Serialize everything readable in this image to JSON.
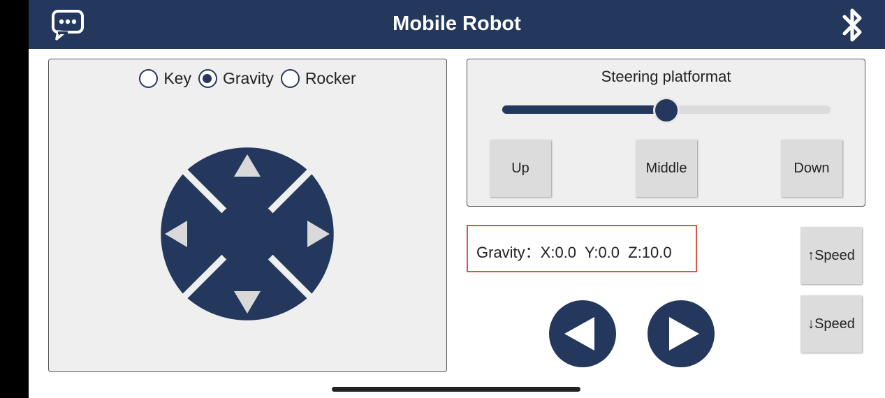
{
  "header": {
    "title": "Mobile Robot",
    "chat_icon": "chat-bubble-icon",
    "bluetooth_icon": "bluetooth-icon",
    "bg_color": "#23385c"
  },
  "control_panel": {
    "modes": [
      {
        "label": "Key",
        "checked": false
      },
      {
        "label": "Gravity",
        "checked": true
      },
      {
        "label": "Rocker",
        "checked": false
      }
    ],
    "dpad": {
      "up_icon": "triangle-up-icon",
      "down_icon": "triangle-down-icon",
      "left_icon": "triangle-left-icon",
      "right_icon": "triangle-right-icon"
    }
  },
  "steering": {
    "title": "Steering platformat",
    "slider_value": 0.5,
    "buttons": {
      "up": "Up",
      "middle": "Middle",
      "down": "Down"
    }
  },
  "gravity": {
    "label": "Gravity：",
    "x": "X:0.0",
    "y": "Y:0.0",
    "z": "Z:10.0",
    "readout": "Gravity：X:0.0  Y:0.0  Z:10.0"
  },
  "rotate": {
    "left_icon": "rotate-left-triangle-icon",
    "right_icon": "rotate-right-triangle-icon"
  },
  "speed": {
    "up": "↑Speed",
    "down": "↓Speed"
  },
  "colors": {
    "accent": "#23385c",
    "panel_bg": "#efefef",
    "button_bg": "#dcdcdc",
    "highlight_border": "#e05050"
  }
}
